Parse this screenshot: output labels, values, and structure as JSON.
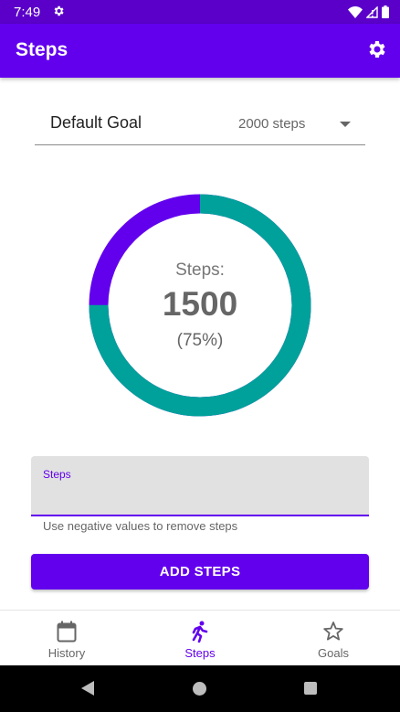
{
  "status_bar": {
    "time": "7:49"
  },
  "app_bar": {
    "title": "Steps"
  },
  "goal": {
    "label": "Default Goal",
    "selected": "2000 steps"
  },
  "progress": {
    "label": "Steps:",
    "count": "1500",
    "percent_text": "(75%)",
    "fraction": 0.75,
    "ring_color": "#00a19a",
    "remaining_color": "#6200ee"
  },
  "steps_input": {
    "label": "Steps",
    "value": "",
    "helper": "Use negative values to remove steps"
  },
  "add_button": {
    "label": "ADD STEPS"
  },
  "bottom_nav": {
    "items": [
      {
        "label": "History"
      },
      {
        "label": "Steps"
      },
      {
        "label": "Goals"
      }
    ]
  },
  "colors": {
    "primary": "#6200ee",
    "status": "#5a00c8",
    "accent": "#00a19a"
  }
}
